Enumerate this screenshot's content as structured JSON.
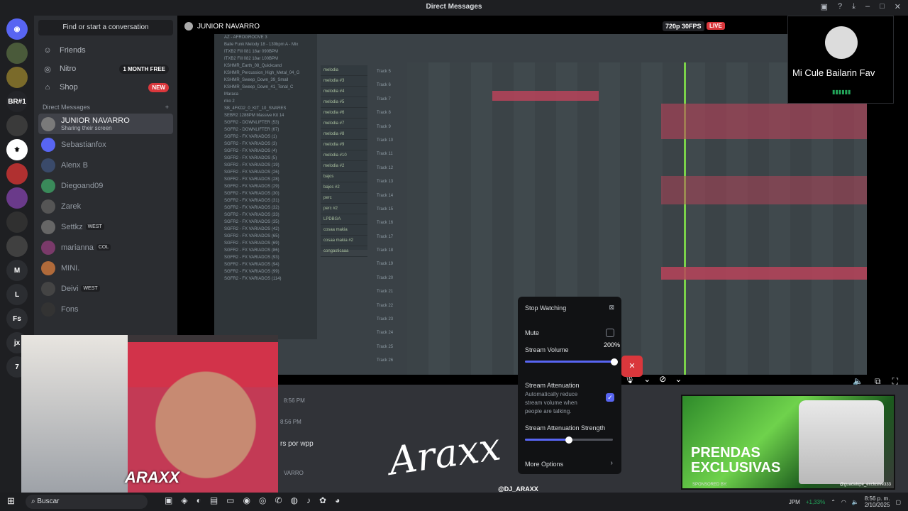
{
  "window": {
    "title": "Direct Messages"
  },
  "servers": [
    "BR#1",
    "M",
    "L",
    "Fs",
    "jx",
    "7"
  ],
  "sidebar": {
    "search_label": "Find or start a conversation",
    "nav": [
      {
        "label": "Friends",
        "icon": "person-wave-icon"
      },
      {
        "label": "Nitro",
        "icon": "nitro-icon",
        "badge": "1 MONTH FREE"
      },
      {
        "label": "Shop",
        "icon": "shop-icon",
        "badge": "NEW"
      }
    ],
    "dm_header": "Direct Messages",
    "dms": [
      {
        "name": "JUNIOR NAVARRO",
        "sub": "Sharing their screen",
        "active": true
      },
      {
        "name": "Sebastianfox"
      },
      {
        "name": "Alenx B"
      },
      {
        "name": "Diegoand09"
      },
      {
        "name": "Zarek"
      },
      {
        "name": "Settkz",
        "tag": "WEST"
      },
      {
        "name": "marianna",
        "tag": "COL"
      },
      {
        "name": "MINI."
      },
      {
        "name": "Deivi",
        "tag": "WEST"
      },
      {
        "name": "Fons"
      }
    ]
  },
  "stream": {
    "user": "JUNIOR NAVARRO",
    "quality": "720p 30FPS",
    "live": "LIVE",
    "browser_items": [
      "AZ - AFROGROOVE 3",
      "Baile Funk Melody 18 - 130bpm A - Mix",
      "ITXB2 Fill 081 18ar 090BPM",
      "ITXB2 Fill 082 18ar 100BPM",
      "KSHMR_Earth_08_Quickcand",
      "KSHMR_Percussion_High_Metal_04_G",
      "KSHMR_Sweep_Down_39_Small",
      "KSHMR_Sweep_Down_41_Tonal_C",
      "Maraca",
      "riko 2",
      "SB_4FKD2_0_KIT_10_SNARES",
      "SEBR2 1288PM Massive Kit 14",
      "SGFR2 - DOWNLIFTER (53)",
      "SGFR2 - DOWNLIFTER (67)",
      "SGFR2 - FX VARIADOS (1)",
      "SGFR2 - FX VARIADOS (3)",
      "SGFR2 - FX VARIADOS (4)",
      "SGFR2 - FX VARIADOS (5)",
      "SGFR2 - FX VARIADOS (19)",
      "SGFR2 - FX VARIADOS (26)",
      "SGFR2 - FX VARIADOS (28)",
      "SGFR2 - FX VARIADOS (29)",
      "SGFR2 - FX VARIADOS (30)",
      "SGFR2 - FX VARIADOS (31)",
      "SGFR2 - FX VARIADOS (32)",
      "SGFR2 - FX VARIADOS (33)",
      "SGFR2 - FX VARIADOS (35)",
      "SGFR2 - FX VARIADOS (42)",
      "SGFR2 - FX VARIADOS (65)",
      "SGFR2 - FX VARIADOS (69)",
      "SGFR2 - FX VARIADOS (86)",
      "SGFR2 - FX VARIADOS (93)",
      "SGFR2 - FX VARIADOS (94)",
      "SGFR2 - FX VARIADOS (99)",
      "SGFR2 - FX VARIADOS (114)"
    ],
    "patterns": [
      "melodia",
      "melodia #3",
      "melodia #4",
      "melodia #5",
      "melodia #6",
      "melodia #7",
      "melodia #8",
      "melodia #9",
      "melodia #10",
      "melodia #2",
      "bajos",
      "bajos #2",
      "perc",
      "perc #2",
      "LPDBGA",
      "cosaa makia",
      "cosaa makia #2",
      "congasticaaa"
    ],
    "tracks": [
      "Track 5",
      "Track 6",
      "Track 7",
      "Track 8",
      "Track 9",
      "Track 10",
      "Track 11",
      "Track 12",
      "Track 13",
      "Track 14",
      "Track 15",
      "Track 16",
      "Track 17",
      "Track 18",
      "Track 19",
      "Track 20",
      "Track 21",
      "Track 22",
      "Track 23",
      "Track 24",
      "Track 25",
      "Track 26"
    ]
  },
  "stream_menu": {
    "stop_watching": "Stop Watching",
    "mute": "Mute",
    "volume_label": "Stream Volume",
    "volume_value": "200%",
    "volume_fraction": 1.0,
    "attenuation_label": "Stream Attenuation",
    "attenuation_desc": "Automatically reduce stream volume when people are talking.",
    "attenuation_checked": true,
    "strength_label": "Stream Attenuation Strength",
    "strength_fraction": 0.5,
    "more_options": "More Options"
  },
  "chat": {
    "time1": "8:56 PM",
    "time2": "8:56 PM",
    "snippet": "rs por wpp",
    "name_fragment": "VARRO"
  },
  "pip": {
    "title": "Mi Cule Bailarin Fav"
  },
  "overlay": {
    "watermark": "Araxx",
    "handle": "@DJ_ARAXX",
    "logo": "ARAXX"
  },
  "ad": {
    "headline_1": "PRENDAS",
    "headline_2": "EXCLUSIVAS",
    "sponsor": "SPONSORED BY:",
    "handle": "@guadalupe_exclusive333"
  },
  "taskbar": {
    "search": "Buscar",
    "ticker": "JPM",
    "ticker_change": "+1,33%",
    "time": "8:56 p. m.",
    "date": "2/10/2025"
  },
  "colors": {
    "accent": "#5865f2",
    "live": "#da373c",
    "playhead": "#7bd24a",
    "online": "#23a55a"
  }
}
